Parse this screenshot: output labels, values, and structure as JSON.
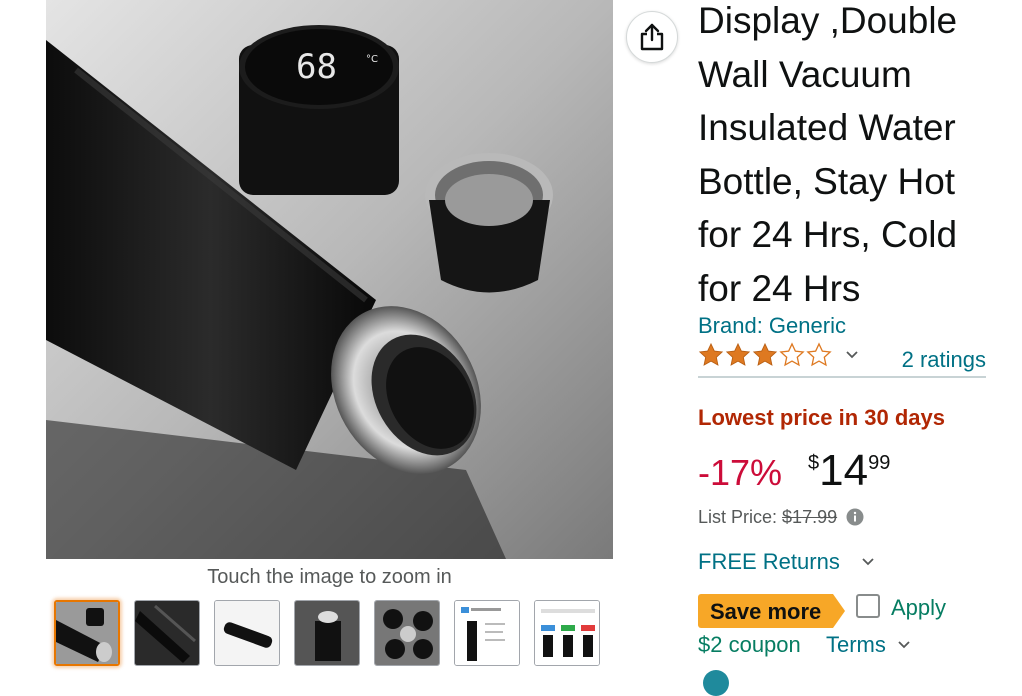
{
  "gallery": {
    "zoom_hint": "Touch the image to zoom in",
    "main_display_reading": "68",
    "main_display_unit": "°C",
    "thumbnails": [
      {
        "label": "thumbnail-1",
        "selected": true
      },
      {
        "label": "thumbnail-2",
        "selected": false
      },
      {
        "label": "thumbnail-3",
        "selected": false
      },
      {
        "label": "thumbnail-4",
        "selected": false
      },
      {
        "label": "thumbnail-5",
        "selected": false
      },
      {
        "label": "thumbnail-6",
        "selected": false
      },
      {
        "label": "thumbnail-7",
        "selected": false
      }
    ]
  },
  "share": {
    "icon": "share-icon"
  },
  "product": {
    "title": "Display ,Double Wall Vacuum Insulated Water Bottle, Stay Hot for 24 Hrs, Cold for 24 Hrs",
    "brand": "Brand: Generic",
    "rating_stars": 3,
    "rating_max": 5,
    "ratings_count": "2 ratings"
  },
  "pricing": {
    "deal_badge": "Lowest price in 30 days",
    "discount": "-17%",
    "currency": "$",
    "price_whole": "14",
    "price_fraction": "99",
    "list_price_label": "List Price:",
    "list_price_value": "$17.99",
    "free_returns": "FREE Returns"
  },
  "coupon": {
    "badge": "Save more",
    "apply_label": "Apply",
    "coupon_text": "$2 coupon",
    "terms_label": "Terms"
  },
  "colors": {
    "link": "#007185",
    "deal_red": "#B12704",
    "discount_red": "#CC0C39",
    "coupon_green": "#067D62",
    "badge_orange": "#F7A727",
    "star_fill": "#DE7921"
  }
}
